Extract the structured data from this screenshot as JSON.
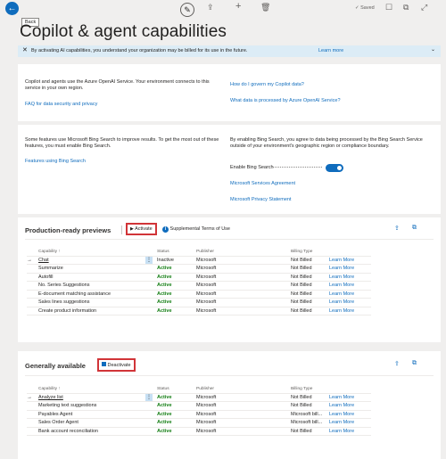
{
  "topbar": {
    "back_tooltip": "Back",
    "saved_label": "✓ Saved"
  },
  "page": {
    "title": "Copilot & agent capabilities"
  },
  "infobar": {
    "message": "By activating AI capabilities, you understand your organization may be billed for its use in the future.",
    "link": "Learn more"
  },
  "azure_section": {
    "text": "Copilot and agents use the Azure OpenAI Service. Your environment connects to this service in your own region.",
    "faq_link": "FAQ for data security and privacy",
    "govern_link": "How do I govern my Copilot data?",
    "processed_link": "What data is processed by Azure OpenAI Service?"
  },
  "bing_section": {
    "text": "Some features use Microsoft Bing Search to improve results. To get the most out of these features, you must enable Bing Search.",
    "features_link": "Features using Bing Search",
    "consent_text": "By enabling Bing Search, you agree to data being processed by the Bing Search Service outside of your environment's geographic region or compliance boundary.",
    "toggle_label": "Enable Bing Search",
    "toggle_on": true,
    "services_link": "Microsoft Services Agreement",
    "privacy_link": "Microsoft Privacy Statement"
  },
  "production": {
    "title": "Production-ready previews",
    "action_label": "Activate",
    "terms_label": "Supplemental Terms of Use",
    "columns": [
      "Capability ↑",
      "Status",
      "Publisher",
      "Billing Type",
      ""
    ],
    "rows": [
      {
        "capability": "Chat",
        "status": "Inactive",
        "publisher": "Microsoft",
        "billing": "Not Billed",
        "link": "Learn More"
      },
      {
        "capability": "Summarize",
        "status": "Active",
        "publisher": "Microsoft",
        "billing": "Not Billed",
        "link": "Learn More"
      },
      {
        "capability": "Autofill",
        "status": "Active",
        "publisher": "Microsoft",
        "billing": "Not Billed",
        "link": "Learn More"
      },
      {
        "capability": "No. Series Suggestions",
        "status": "Active",
        "publisher": "Microsoft",
        "billing": "Not Billed",
        "link": "Learn More"
      },
      {
        "capability": "E-document matching assistance",
        "status": "Active",
        "publisher": "Microsoft",
        "billing": "Not Billed",
        "link": "Learn More"
      },
      {
        "capability": "Sales lines suggestions",
        "status": "Active",
        "publisher": "Microsoft",
        "billing": "Not Billed",
        "link": "Learn More"
      },
      {
        "capability": "Create product information",
        "status": "Active",
        "publisher": "Microsoft",
        "billing": "Not Billed",
        "link": "Learn More"
      }
    ]
  },
  "general": {
    "title": "Generally available",
    "action_label": "Deactivate",
    "columns": [
      "Capability ↑",
      "Status",
      "Publisher",
      "Billing Type",
      ""
    ],
    "rows": [
      {
        "capability": "Analyze list",
        "status": "Active",
        "publisher": "Microsoft",
        "billing": "Not Billed",
        "link": "Learn More"
      },
      {
        "capability": "Marketing text suggestions",
        "status": "Active",
        "publisher": "Microsoft",
        "billing": "Not Billed",
        "link": "Learn More"
      },
      {
        "capability": "Payables Agent",
        "status": "Active",
        "publisher": "Microsoft",
        "billing": "Microsoft bill...",
        "link": "Learn More"
      },
      {
        "capability": "Sales Order Agent",
        "status": "Active",
        "publisher": "Microsoft",
        "billing": "Microsoft bill...",
        "link": "Learn More"
      },
      {
        "capability": "Bank account reconciliation",
        "status": "Active",
        "publisher": "Microsoft",
        "billing": "Not Billed",
        "link": "Learn More"
      }
    ]
  },
  "colors": {
    "accent": "#0f6cbd",
    "active_green": "#107c10",
    "highlight_red": "#d13438",
    "info_bg": "#dcecf6"
  }
}
